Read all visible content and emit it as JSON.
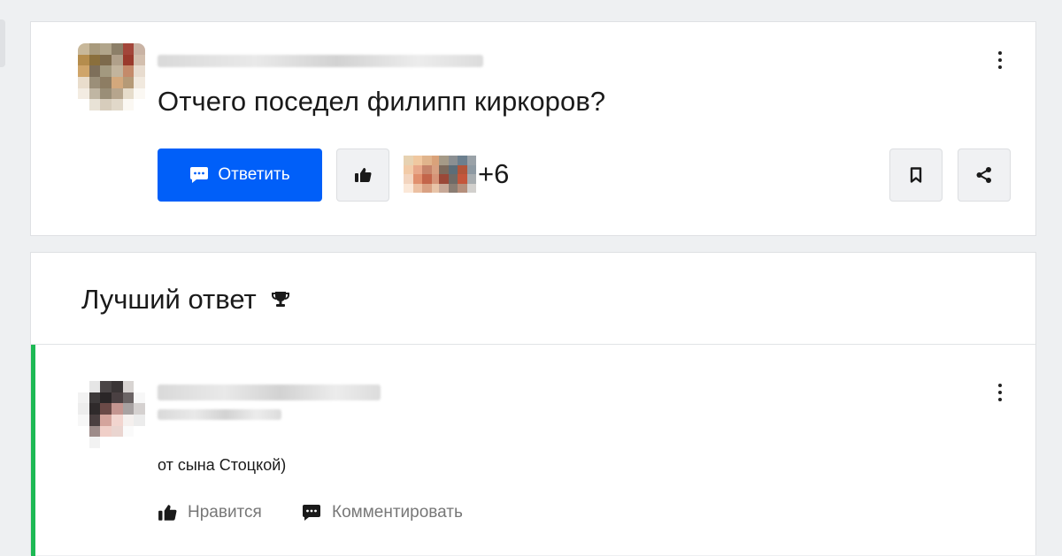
{
  "question": {
    "text": "Отчего поседел филипп киркоров?",
    "reply_label": "Ответить",
    "likes_extra": "+6"
  },
  "best_answer": {
    "title": "Лучший ответ",
    "text": "от сына Стоцкой)",
    "like_label": "Нравится",
    "comment_label": "Комментировать"
  },
  "colors": {
    "accent": "#005ff9",
    "best_answer_bar": "#1db954"
  },
  "icons": [
    "comment-icon",
    "thumbs-up-icon",
    "bookmark-icon",
    "share-icon",
    "trophy-icon",
    "more-vertical-icon"
  ]
}
